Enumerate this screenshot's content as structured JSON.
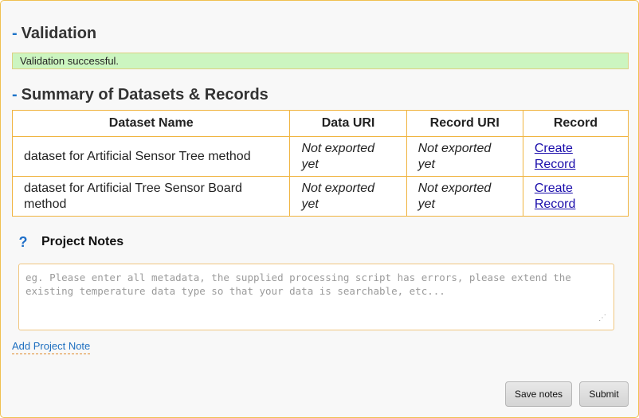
{
  "validation": {
    "dash": "-",
    "heading": "Validation",
    "message": "Validation successful."
  },
  "summary": {
    "dash": "-",
    "heading": "Summary of Datasets & Records",
    "columns": [
      "Dataset Name",
      "Data URI",
      "Record URI",
      "Record"
    ],
    "rows": [
      {
        "dataset_name": "dataset for Artificial Sensor Tree method",
        "data_uri": "Not exported yet",
        "record_uri": "Not exported yet",
        "record_link": "Create Record"
      },
      {
        "dataset_name": "dataset for Artificial Tree Sensor Board method",
        "data_uri": "Not exported yet",
        "record_uri": "Not exported yet",
        "record_link": "Create Record"
      }
    ]
  },
  "project_notes": {
    "help_glyph": "?",
    "title": "Project Notes",
    "placeholder": "eg. Please enter all metadata, the supplied processing script has errors, please extend the existing temperature data type so that your data is searchable, etc...",
    "value": "",
    "add_link": "Add Project Note"
  },
  "buttons": {
    "save": "Save notes",
    "submit": "Submit"
  },
  "colors": {
    "accent": "#1e74c8",
    "border": "#f0b440",
    "success_bg": "#ccf5c0",
    "link": "#1a0dab"
  },
  "icons": {
    "help": "help-icon",
    "resize": "resize-grip-icon"
  }
}
